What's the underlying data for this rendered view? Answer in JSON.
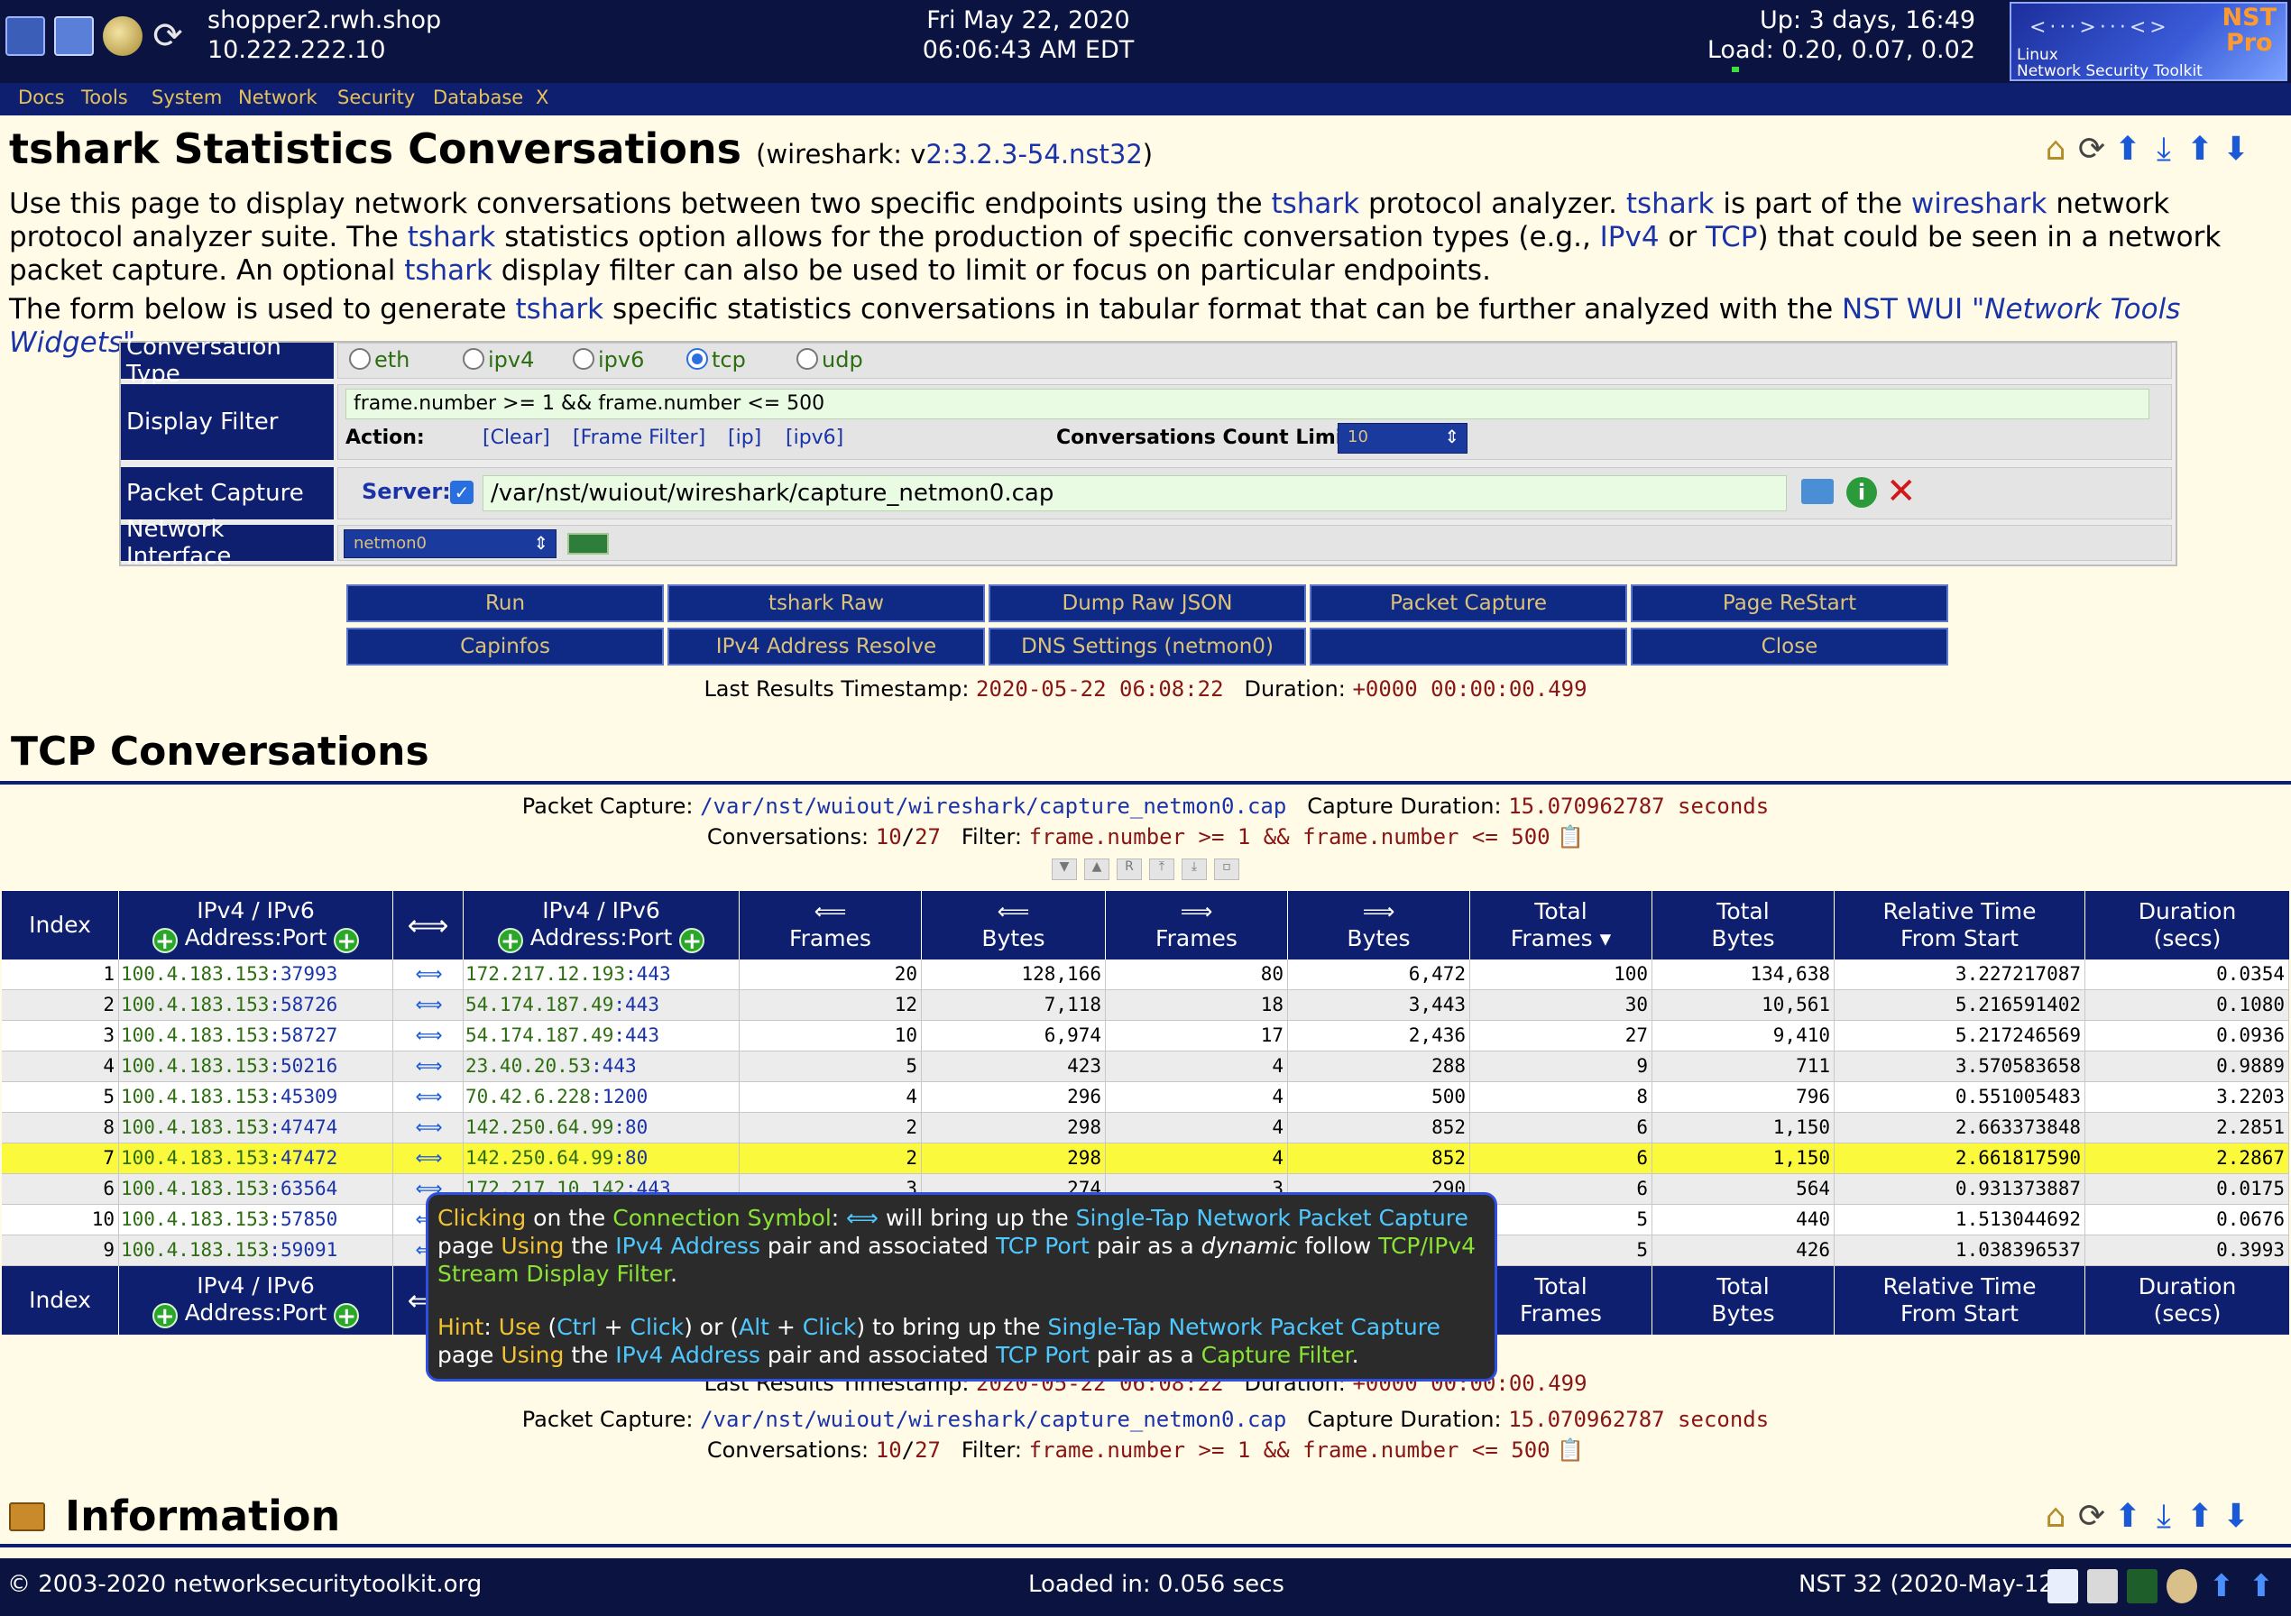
{
  "topbar": {
    "host": "shopper2.rwh.shop",
    "ip": "10.222.222.10",
    "date": "Fri May 22, 2020",
    "time": "06:06:43 AM EDT",
    "uptime": "Up: 3 days, 16:49",
    "load": "Load: 0.20, 0.07, 0.02",
    "logo_nst": "NST",
    "logo_pro": "Pro",
    "logo_line1": "Linux",
    "logo_line2": "Network Security Toolkit"
  },
  "menu": [
    "Docs",
    "Tools",
    "System",
    "Network",
    "Security",
    "Database",
    "X"
  ],
  "title": {
    "main": "tshark Statistics Conversations",
    "ver_prefix": "(wireshark: v",
    "ver_link": "2:3.2.3-54.nst32",
    "ver_suffix": ")"
  },
  "intro": {
    "p1_a": "Use this page to display network conversations between two specific endpoints using the ",
    "p1_tshark": "tshark",
    "p1_b": " protocol analyzer. ",
    "p1_c": " is part of the ",
    "p1_wireshark": "wireshark",
    "p1_d": " network protocol analyzer suite. The ",
    "p1_e": " statistics option allows for the production of specific conversation types (e.g., ",
    "p1_ipv4": "IPv4",
    "p1_or": " or ",
    "p1_tcp": "TCP",
    "p1_f": ") that could be seen in a network packet capture. An optional ",
    "p1_g": " display filter can also be used to limit or focus on particular endpoints.",
    "p2_a": "The form below is used to generate ",
    "p2_b": " specific statistics conversations in tabular format that can be further analyzed with the ",
    "p2_wui": "NST WUI",
    "p2_widgets": "\"Network Tools Widgets\"",
    "p2_c": "."
  },
  "form": {
    "conv_type_label": "Conversation Type",
    "types": [
      "eth",
      "ipv4",
      "ipv6",
      "tcp",
      "udp"
    ],
    "selected_type": "tcp",
    "display_filter_label": "Display Filter",
    "display_filter_value": "frame.number >= 1 && frame.number <= 500",
    "action_label": "Action:",
    "actions": [
      "[Clear]",
      "[Frame Filter]",
      "[ip]",
      "[ipv6]"
    ],
    "count_limit_label": "Conversations Count Limit:",
    "count_limit_value": "10",
    "packet_capture_label": "Packet Capture",
    "server_label": "Server:",
    "capture_path": "/var/nst/wuiout/wireshark/capture_netmon0.cap",
    "net_if_label": "Network Interface",
    "net_if_value": "netmon0"
  },
  "buttons": {
    "row1": [
      "Run",
      "tshark Raw",
      "Dump Raw JSON",
      "Packet Capture",
      "Page ReStart"
    ],
    "row2": [
      "Capinfos",
      "IPv4 Address Resolve",
      "DNS Settings (netmon0)",
      "",
      "Close"
    ]
  },
  "results": {
    "ts_label": "Last Results Timestamp:",
    "ts_value": "2020-05-22 06:08:22",
    "dur_label": "Duration:",
    "dur_value": "+0000 00:00:00.499"
  },
  "conv": {
    "heading": "TCP Conversations",
    "pc_label": "Packet Capture:",
    "pc_value": "/var/nst/wuiout/wireshark/capture_netmon0.cap",
    "cd_label": "Capture Duration:",
    "cd_value": "15.070962787 seconds",
    "count_label": "Conversations:",
    "count_shown": "10",
    "count_total": "27",
    "filter_label": "Filter:",
    "filter_value": "frame.number >= 1 && frame.number <= 500"
  },
  "table": {
    "headers": {
      "index": "Index",
      "addr_top": "IPv4 / IPv6",
      "addr_bottom": "Address:Port",
      "sym": "⟺",
      "left": "⟸",
      "right": "⟹",
      "frames": "Frames",
      "bytes": "Bytes",
      "total_frames_a": "Total",
      "total_frames_b": "Frames",
      "total_frames_sort": "▾",
      "total_bytes_a": "Total",
      "total_bytes_b": "Bytes",
      "rel_a": "Relative Time",
      "rel_b": "From Start",
      "dur_a": "Duration",
      "dur_b": "(secs)"
    },
    "rows": [
      {
        "idx": "1",
        "a_ip": "100.4.183.153",
        "a_port": "37993",
        "b_ip": "172.217.12.193",
        "b_port": "443",
        "lf": "20",
        "lb": "128,166",
        "rf": "80",
        "rb": "6,472",
        "tf": "100",
        "tb": "134,638",
        "rel": "3.227217087",
        "dur": "0.0354"
      },
      {
        "idx": "2",
        "a_ip": "100.4.183.153",
        "a_port": "58726",
        "b_ip": "54.174.187.49",
        "b_port": "443",
        "lf": "12",
        "lb": "7,118",
        "rf": "18",
        "rb": "3,443",
        "tf": "30",
        "tb": "10,561",
        "rel": "5.216591402",
        "dur": "0.1080"
      },
      {
        "idx": "3",
        "a_ip": "100.4.183.153",
        "a_port": "58727",
        "b_ip": "54.174.187.49",
        "b_port": "443",
        "lf": "10",
        "lb": "6,974",
        "rf": "17",
        "rb": "2,436",
        "tf": "27",
        "tb": "9,410",
        "rel": "5.217246569",
        "dur": "0.0936"
      },
      {
        "idx": "4",
        "a_ip": "100.4.183.153",
        "a_port": "50216",
        "b_ip": "23.40.20.53",
        "b_port": "443",
        "lf": "5",
        "lb": "423",
        "rf": "4",
        "rb": "288",
        "tf": "9",
        "tb": "711",
        "rel": "3.570583658",
        "dur": "0.9889"
      },
      {
        "idx": "5",
        "a_ip": "100.4.183.153",
        "a_port": "45309",
        "b_ip": "70.42.6.228",
        "b_port": "1200",
        "lf": "4",
        "lb": "296",
        "rf": "4",
        "rb": "500",
        "tf": "8",
        "tb": "796",
        "rel": "0.551005483",
        "dur": "3.2203"
      },
      {
        "idx": "8",
        "a_ip": "100.4.183.153",
        "a_port": "47474",
        "b_ip": "142.250.64.99",
        "b_port": "80",
        "lf": "2",
        "lb": "298",
        "rf": "4",
        "rb": "852",
        "tf": "6",
        "tb": "1,150",
        "rel": "2.663373848",
        "dur": "2.2851"
      },
      {
        "idx": "7",
        "a_ip": "100.4.183.153",
        "a_port": "47472",
        "b_ip": "142.250.64.99",
        "b_port": "80",
        "lf": "2",
        "lb": "298",
        "rf": "4",
        "rb": "852",
        "tf": "6",
        "tb": "1,150",
        "rel": "2.661817590",
        "dur": "2.2867",
        "hl": true
      },
      {
        "idx": "6",
        "a_ip": "100.4.183.153",
        "a_port": "63564",
        "b_ip": "172.217.10.142",
        "b_port": "443",
        "lf": "3",
        "lb": "274",
        "rf": "3",
        "rb": "290",
        "tf": "6",
        "tb": "564",
        "rel": "0.931373887",
        "dur": "0.0175"
      },
      {
        "idx": "10",
        "a_ip": "100.4.183.153",
        "a_port": "57850",
        "b_ip": "",
        "b_port": "",
        "lf": "",
        "lb": "",
        "rf": "",
        "rb": "",
        "tf": "5",
        "tb": "440",
        "rel": "1.513044692",
        "dur": "0.0676"
      },
      {
        "idx": "9",
        "a_ip": "100.4.183.153",
        "a_port": "59091",
        "b_ip": "",
        "b_port": "",
        "lf": "",
        "lb": "",
        "rf": "",
        "rb": "",
        "tf": "5",
        "tb": "426",
        "rel": "1.038396537",
        "dur": "0.3993"
      }
    ]
  },
  "tooltip": {
    "l1_clicking": "Clicking",
    "l1_a": " on the ",
    "l1_conn": "Connection Symbol",
    "l1_b": ": ",
    "l1_sym": "⟺",
    "l1_c": " will bring up the ",
    "l1_stnpc": "Single-Tap Network Packet Capture",
    "l2_page": "page ",
    "l2_using": "Using",
    "l2_the": " the ",
    "l2_ipv4": "IPv4 Address",
    "l2_pair": " pair and associated ",
    "l2_tcp": "TCP Port",
    "l2_as": " pair as a ",
    "l2_dyn": "dynamic",
    "l2_follow": " follow ",
    "l2_filter": "TCP/IPv4",
    "l3_filter": "Stream Display Filter",
    "l3_dot": ".",
    "l4_hint": "Hint",
    "l4_colon": ":   ",
    "l4_use": "Use",
    "l4_a": " (",
    "l4_ctrl": "Ctrl",
    "l4_plus": " + ",
    "l4_click": "Click",
    "l4_b": ") or (",
    "l4_alt": "Alt",
    "l4_c": ") to bring up the ",
    "l5_filter": "Capture Filter"
  },
  "bottom": {
    "ts_label": "Last Results Timestamp:",
    "ts_value": "2020-05-22 06:08:22",
    "dur_label": "Duration:",
    "dur_value": "+0000 00:00:00.499"
  },
  "info": {
    "heading": "Information"
  },
  "footer": {
    "copyright": "© 2003-2020 networksecuritytoolkit.org",
    "loaded": "Loaded in: 0.056 secs",
    "version": "NST 32 (2020-May-12)"
  }
}
